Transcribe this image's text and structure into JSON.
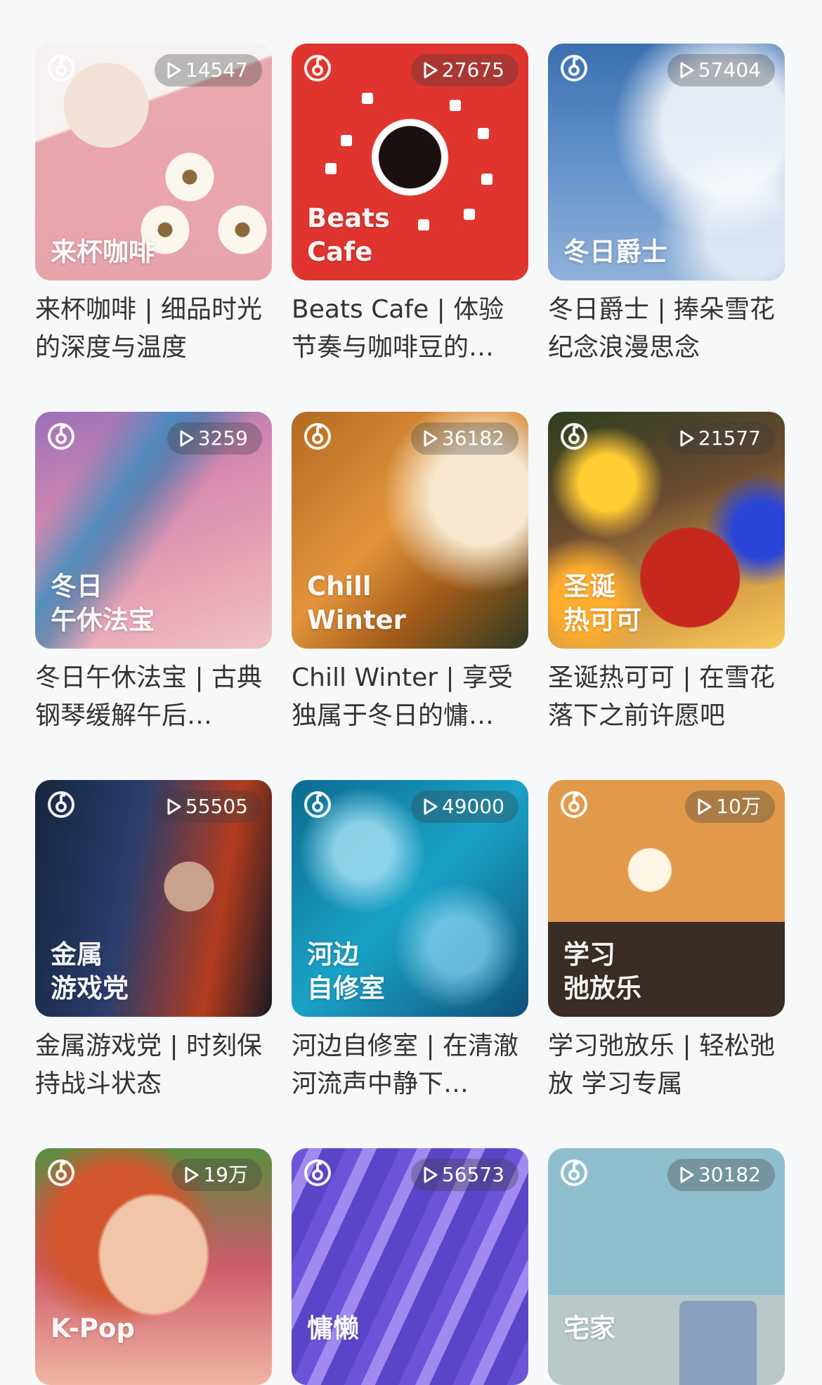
{
  "cards": [
    {
      "cover_title": "来杯咖啡",
      "play_count": "14547",
      "caption": "来杯咖啡 | 细品时光的深度与温度"
    },
    {
      "cover_title": "Beats\nCafe",
      "play_count": "27675",
      "caption": "Beats Cafe | 体验节奏与咖啡豆的…"
    },
    {
      "cover_title": "冬日爵士",
      "play_count": "57404",
      "caption": "冬日爵士 | 捧朵雪花纪念浪漫思念"
    },
    {
      "cover_title": "冬日\n午休法宝",
      "play_count": "3259",
      "caption": "冬日午休法宝 | 古典钢琴缓解午后…"
    },
    {
      "cover_title": "Chill\nWinter",
      "play_count": "36182",
      "caption": "Chill Winter | 享受独属于冬日的慵…"
    },
    {
      "cover_title": "圣诞\n热可可",
      "play_count": "21577",
      "caption": "圣诞热可可 | 在雪花落下之前许愿吧"
    },
    {
      "cover_title": "金属\n游戏党",
      "play_count": "55505",
      "caption": "金属游戏党 | 时刻保持战斗状态"
    },
    {
      "cover_title": "河边\n自修室",
      "play_count": "49000",
      "caption": "河边自修室 | 在清澈河流声中静下…"
    },
    {
      "cover_title": "学习\n弛放乐",
      "play_count": "10万",
      "caption": "学习弛放乐 | 轻松弛放 学习专属"
    },
    {
      "cover_title": "K-Pop",
      "play_count": "19万",
      "caption": ""
    },
    {
      "cover_title": "慵懒",
      "play_count": "56573",
      "caption": ""
    },
    {
      "cover_title": "宅家",
      "play_count": "30182",
      "caption": ""
    }
  ],
  "icons": {
    "brand": "netease-cloud-music-icon",
    "play": "play-triangle-icon"
  }
}
